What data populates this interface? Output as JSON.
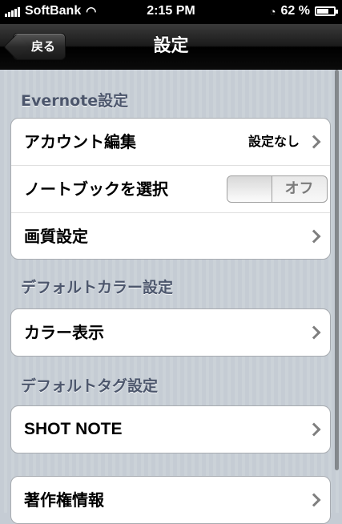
{
  "status": {
    "carrier": "SoftBank",
    "time": "2:15 PM",
    "battery_percent": "62 %",
    "battery_level": 0.62
  },
  "navbar": {
    "back_label": "戻る",
    "title": "設定"
  },
  "sections": [
    {
      "header": "Evernote設定",
      "rows": [
        {
          "label": "アカウント編集",
          "detail": "設定なし",
          "accessory": "chevron-icon"
        },
        {
          "label": "ノートブックを選択",
          "toggle": "オフ",
          "toggle_on": false
        },
        {
          "label": "画質設定",
          "accessory": "chevron-icon"
        }
      ]
    },
    {
      "header": "デフォルトカラー設定",
      "rows": [
        {
          "label": "カラー表示",
          "accessory": "chevron-icon"
        }
      ]
    },
    {
      "header": "デフォルトタグ設定",
      "rows": [
        {
          "label": "SHOT NOTE",
          "accessory": "chevron-icon"
        }
      ]
    },
    {
      "header": "",
      "rows": [
        {
          "label": "著作権情報",
          "accessory": "chevron-icon"
        }
      ]
    }
  ],
  "colors": {
    "background": "#c5ccd4",
    "section_header": "#4c566c",
    "navbar": "#000000"
  }
}
